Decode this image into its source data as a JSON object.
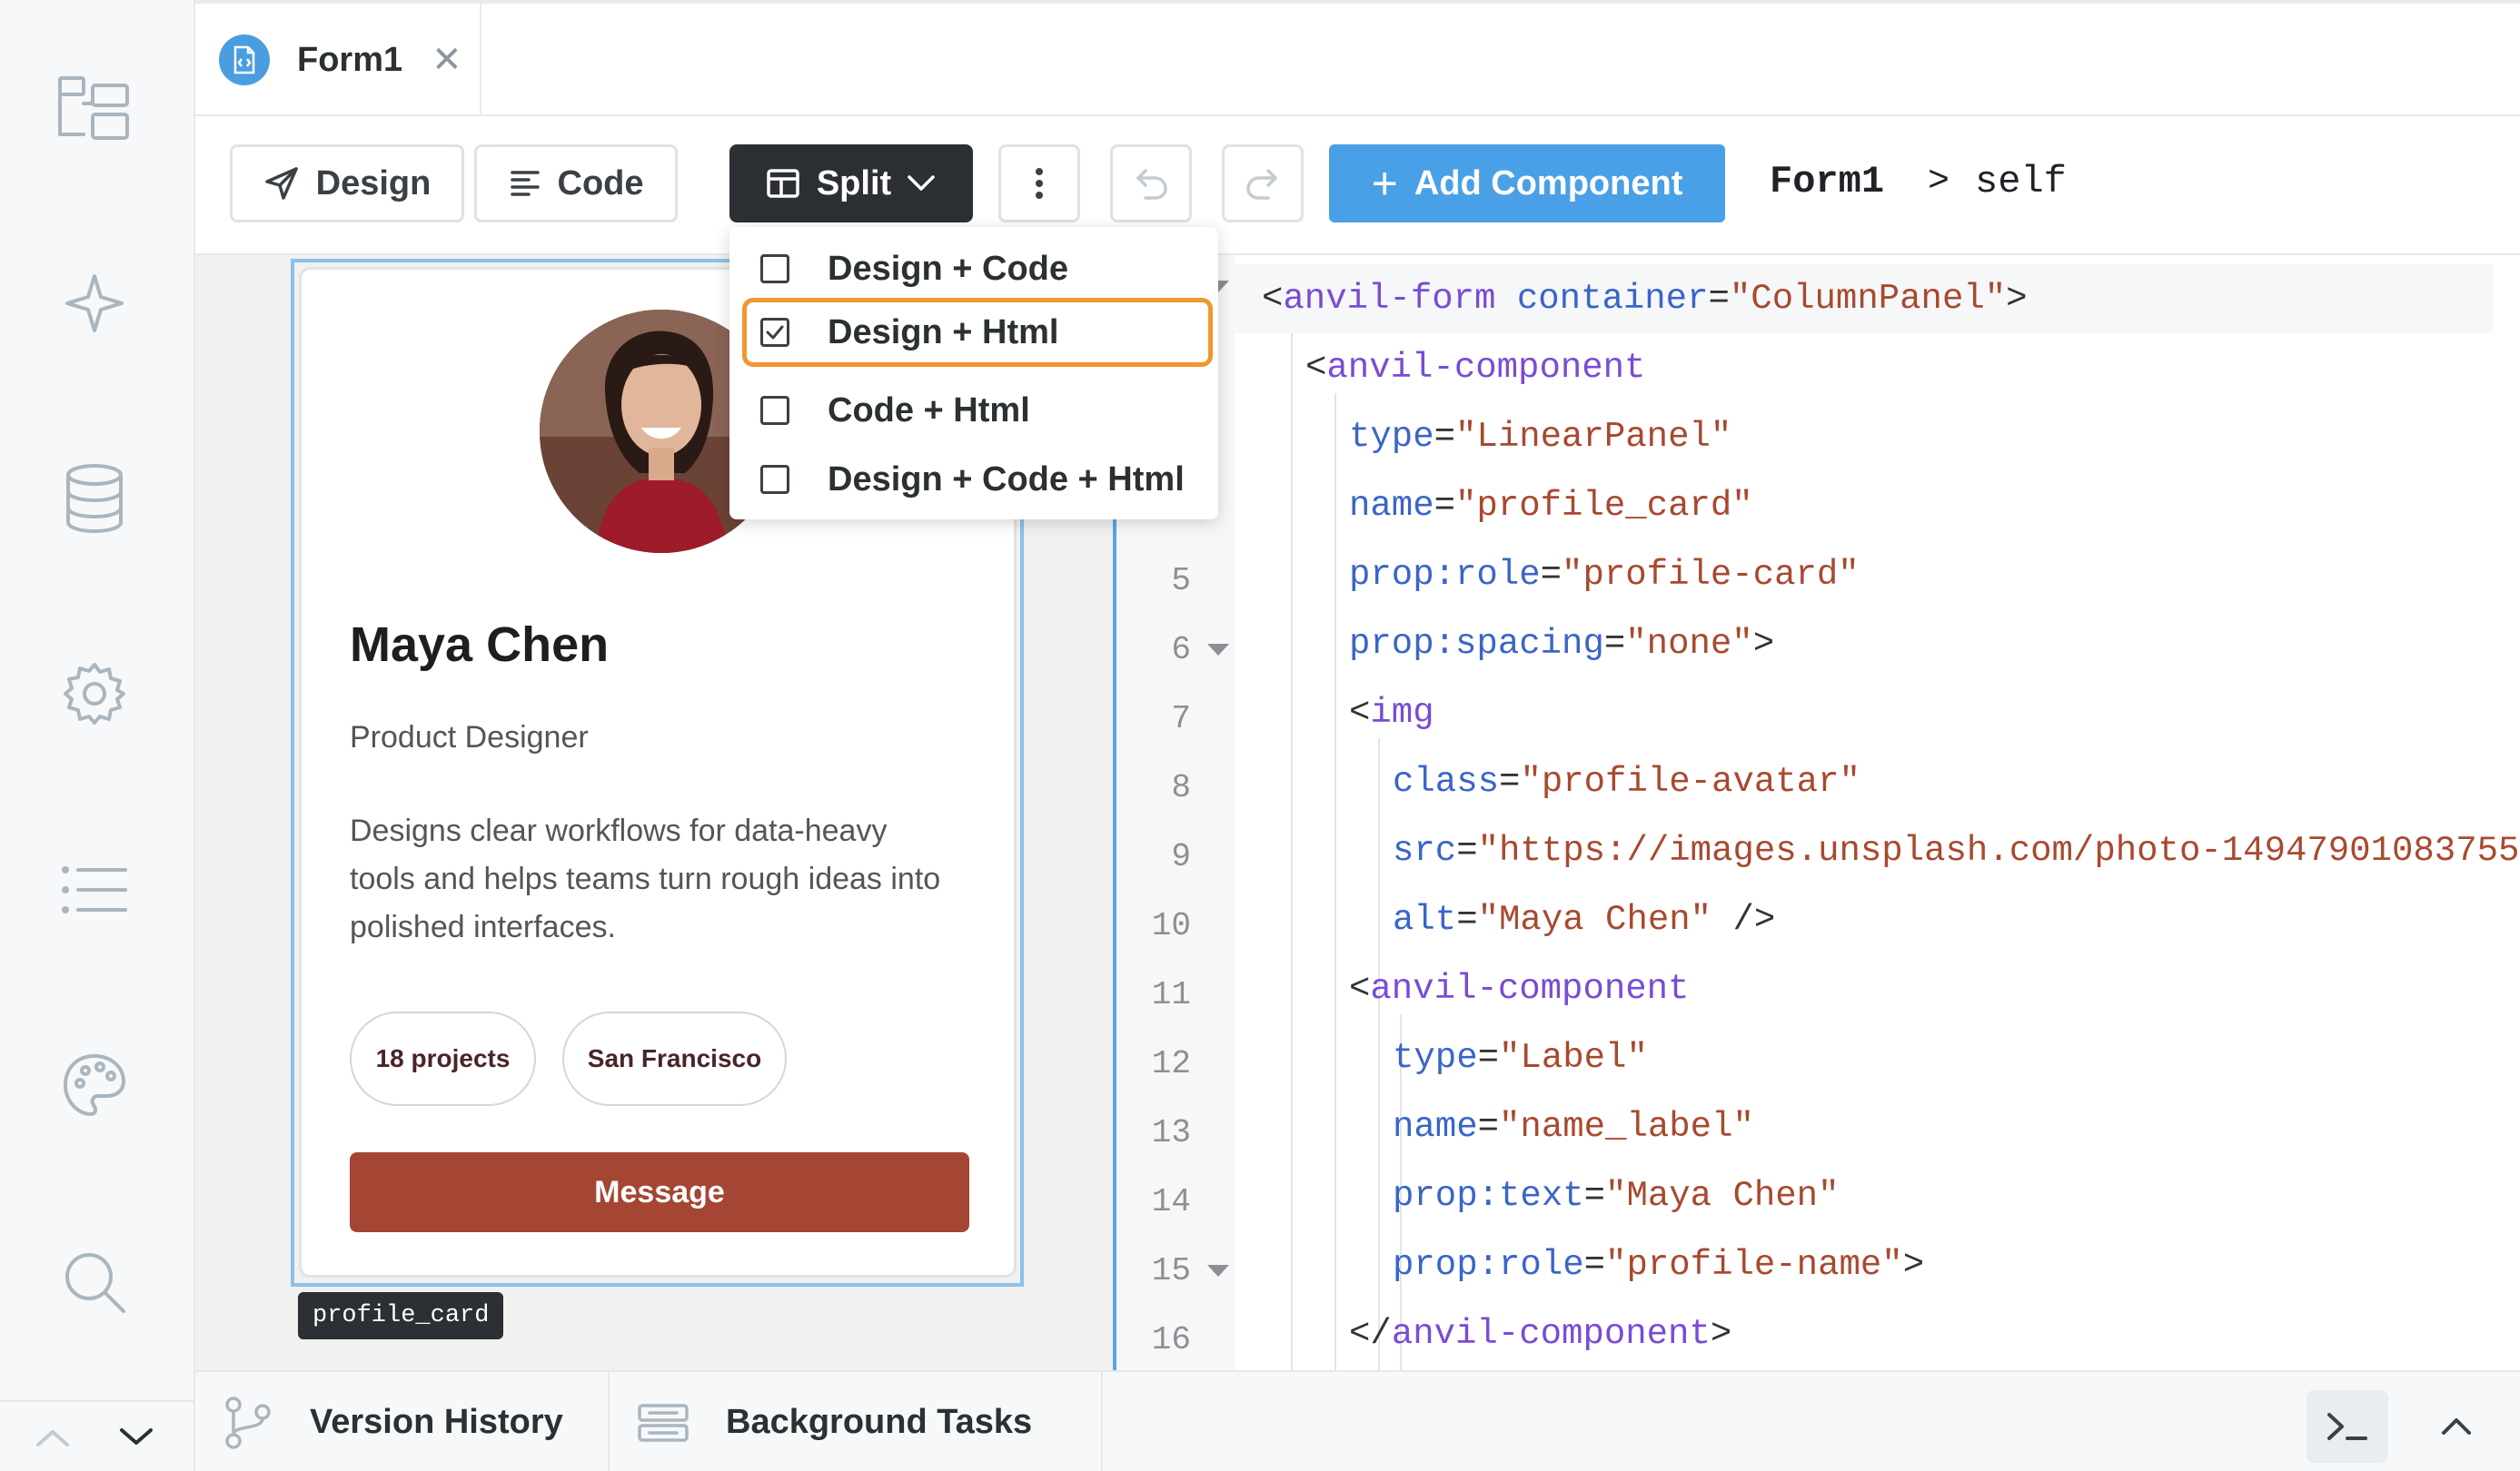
{
  "sidebar": {
    "icons": [
      "app-structure-icon",
      "sparkle-icon",
      "database-icon",
      "settings-gear-icon",
      "list-icon",
      "palette-icon",
      "search-icon"
    ]
  },
  "tab": {
    "name": "Form1",
    "close": "✕"
  },
  "toolbar": {
    "design_label": "Design",
    "code_label": "Code",
    "split_label": "Split",
    "add_component_label": "Add Component",
    "breadcrumb_form": "Form1",
    "breadcrumb_sep": ">",
    "breadcrumb_self": "self"
  },
  "split_menu": {
    "options": [
      {
        "label": "Design + Code",
        "checked": false
      },
      {
        "label": "Design + Html",
        "checked": true
      },
      {
        "label": "Code + Html",
        "checked": false
      },
      {
        "label": "Design + Code + Html",
        "checked": false
      }
    ]
  },
  "profile_card": {
    "name": "Maya Chen",
    "role": "Product Designer",
    "bio": "Designs clear workflows for data-heavy tools and helps teams turn rough ideas into polished interfaces.",
    "chips": [
      "18 projects",
      "San Francisco"
    ],
    "button": "Message",
    "selection_tag": "profile_card"
  },
  "code": {
    "line_numbers": [
      "5",
      "6",
      "7",
      "8",
      "9",
      "10",
      "11",
      "12",
      "13",
      "14",
      "15",
      "16"
    ],
    "lines": [
      [
        "<",
        "anvil-form",
        " ",
        "container",
        "=",
        "\"ColumnPanel\"",
        ">"
      ],
      [
        "<",
        "anvil-component"
      ],
      [
        "type",
        "=",
        "\"LinearPanel\""
      ],
      [
        "name",
        "=",
        "\"profile_card\""
      ],
      [
        "prop:role",
        "=",
        "\"profile-card\""
      ],
      [
        "prop:spacing",
        "=",
        "\"none\"",
        ">"
      ],
      [
        "<",
        "img"
      ],
      [
        "class",
        "=",
        "\"profile-avatar\""
      ],
      [
        "src",
        "=",
        "\"https://images.unsplash.com/photo-14947901083755-2616b612b786?w=400\""
      ],
      [
        "alt",
        "=",
        "\"Maya Chen\"",
        " />"
      ],
      [
        "<",
        "anvil-component"
      ],
      [
        "type",
        "=",
        "\"Label\""
      ],
      [
        "name",
        "=",
        "\"name_label\""
      ],
      [
        "prop:text",
        "=",
        "\"Maya Chen\""
      ],
      [
        "prop:role",
        "=",
        "\"profile-name\"",
        ">"
      ],
      [
        "</",
        "anvil-component",
        ">"
      ]
    ]
  },
  "bottom": {
    "version_history": "Version History",
    "background_tasks": "Background Tasks"
  },
  "colors": {
    "accent": "#4aa0e6",
    "split_active": "#2c2f33",
    "focus_ring": "#f0972f",
    "message_button": "#a44633"
  }
}
